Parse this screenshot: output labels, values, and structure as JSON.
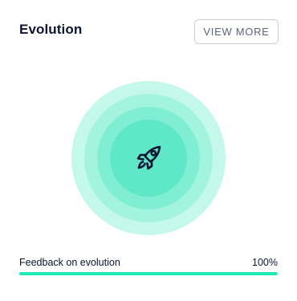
{
  "card": {
    "title": "Evolution",
    "view_more_label": "VIEW MORE"
  },
  "illustration": {
    "icon": "rocket-icon",
    "ring_colors": [
      "#c4f8eb",
      "#a3f4df",
      "#80eed3",
      "#5fe8c8"
    ],
    "icon_color": "#0b1533"
  },
  "progress": {
    "label": "Feedback on evolution",
    "value_text": "100%",
    "value": 1.0,
    "fill_color": "#1de9b6",
    "track_color": "#e6ebf2"
  }
}
